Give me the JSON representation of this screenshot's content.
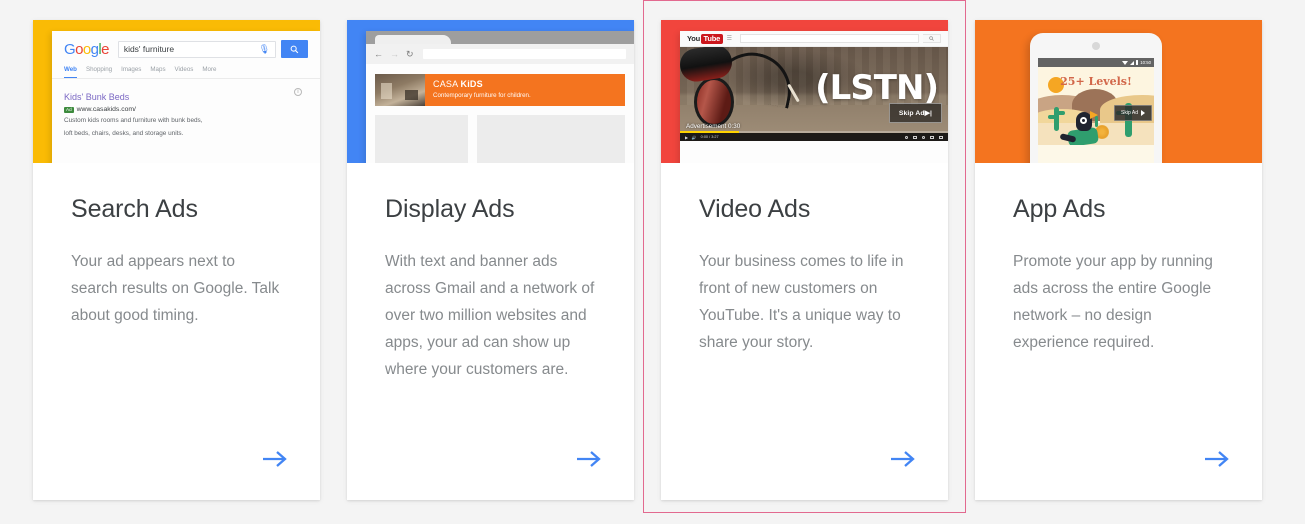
{
  "theme": {
    "page_background": "#f4f4f4",
    "card_background": "#ffffff",
    "title_color": "#3c4043",
    "body_color": "#868a8d",
    "arrow_color": "#4285f4",
    "selected_border_color": "#e2698f"
  },
  "cards": [
    {
      "id": "search-ads",
      "title": "Search Ads",
      "description": "Your ad appears next to search results on Google. Talk about good timing.",
      "selected": false,
      "thumbnail_background": "#fabb05",
      "arrow_icon": "arrow-right-icon",
      "preview": {
        "kind": "google-search-results",
        "logo": "Google",
        "query": "kids' furniture",
        "mic_icon": "microphone-icon",
        "search_icon": "search-icon",
        "tabs": [
          "Web",
          "Shopping",
          "Images",
          "Maps",
          "Videos",
          "More"
        ],
        "active_tab": "Web",
        "result_title": "Kids' Bunk Beds",
        "ad_badge": "Ad",
        "result_url": "www.casakids.com/",
        "result_snippet_line1": "Custom kids rooms and furniture with bunk beds,",
        "result_snippet_line2": "loft beds, chairs, desks, and storage units.",
        "info_icon": "info-icon"
      }
    },
    {
      "id": "display-ads",
      "title": "Display Ads",
      "description": "With text and banner ads across Gmail and a network of over two million websites and apps, your ad can show up where your customers are.",
      "selected": false,
      "thumbnail_background": "#4285f4",
      "arrow_icon": "arrow-right-icon",
      "preview": {
        "kind": "browser-banner-ad",
        "back_icon": "arrow-left-icon",
        "forward_icon": "arrow-right-icon",
        "reload_icon": "reload-icon",
        "banner_brand_light": "CASA",
        "banner_brand_bold": "KiDS",
        "banner_tagline": "Contemporary furniture for children."
      }
    },
    {
      "id": "video-ads",
      "title": "Video Ads",
      "description": "Your business comes to life in front of new customers on YouTube. It's a unique way to share your story.",
      "selected": true,
      "thumbnail_background": "#f1453d",
      "arrow_icon": "arrow-right-icon",
      "preview": {
        "kind": "youtube-player",
        "logo_you": "You",
        "logo_tube": "Tube",
        "menu_icon": "hamburger-icon",
        "search_icon": "search-icon",
        "brand_overlay": "(LSTN)",
        "ad_label": "Advertisement 0:30",
        "skip_label": "Skip Ad",
        "skip_icon": "skip-next-icon",
        "play_icon": "play-icon",
        "volume_icon": "volume-icon",
        "time": "0:00 / 3:27",
        "settings_icon": "gear-icon",
        "captions_icon": "captions-icon",
        "theater_icon": "theater-mode-icon",
        "fullscreen_icon": "fullscreen-icon"
      }
    },
    {
      "id": "app-ads",
      "title": "App Ads",
      "description": "Promote your app by running ads across the entire Google network – no design experience required.",
      "selected": false,
      "thumbnail_background": "#f4741f",
      "arrow_icon": "arrow-right-icon",
      "preview": {
        "kind": "phone-game-ad",
        "status_time": "10:50",
        "wifi_icon": "wifi-icon",
        "signal_icon": "signal-icon",
        "battery_icon": "battery-icon",
        "headline": "25+ Levels!",
        "skip_label": "Skip Ad",
        "skip_icon": "skip-next-icon"
      }
    }
  ]
}
